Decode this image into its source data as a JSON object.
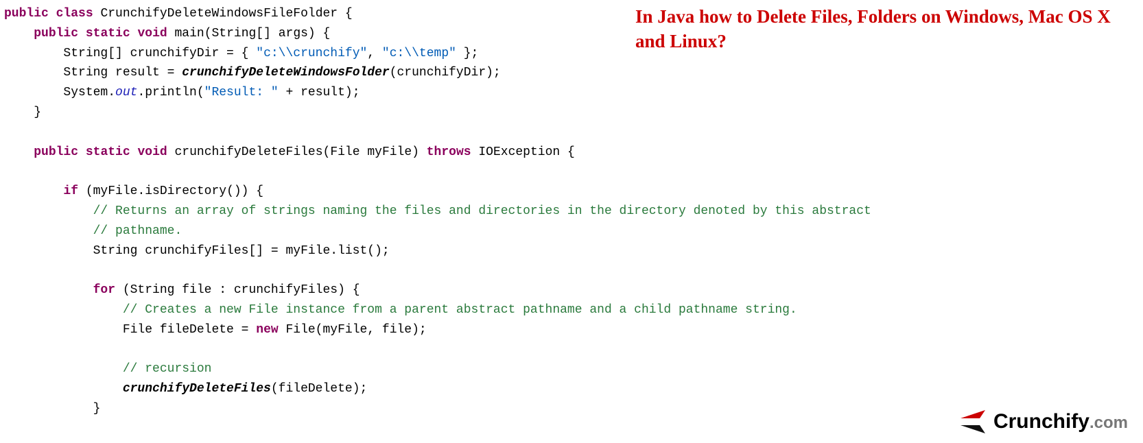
{
  "title": "In Java how to Delete Files, Folders on Windows, Mac OS X and Linux?",
  "code": {
    "l1_kw1": "public",
    "l1_kw2": "class",
    "l1_name": "CrunchifyDeleteWindowsFileFolder",
    "l1_brace": " {",
    "l2_kw1": "public",
    "l2_kw2": "static",
    "l2_kw3": "void",
    "l2_rest": " main(String[] args) {",
    "l3_pre": "        String[] crunchifyDir = { ",
    "l3_s1": "\"c:\\\\crunchify\"",
    "l3_mid": ", ",
    "l3_s2": "\"c:\\\\temp\"",
    "l3_post": " };",
    "l4_pre": "        String result = ",
    "l4_call": "crunchifyDeleteWindowsFolder",
    "l4_post": "(crunchifyDir);",
    "l5_pre": "        System.",
    "l5_out": "out",
    "l5_mid": ".println(",
    "l5_s": "\"Result: \"",
    "l5_post": " + result);",
    "l6": "    }",
    "l7_kw1": "public",
    "l7_kw2": "static",
    "l7_kw3": "void",
    "l7_name": " crunchifyDeleteFiles(File myFile) ",
    "l7_kw4": "throws",
    "l7_post": " IOException {",
    "l8_kw": "if",
    "l8_post": " (myFile.isDirectory()) {",
    "l9": "            // Returns an array of strings naming the files and directories in the directory denoted by this abstract",
    "l10": "            // pathname.",
    "l11": "            String crunchifyFiles[] = myFile.list();",
    "l12_kw": "for",
    "l12_post": " (String file : crunchifyFiles) {",
    "l13": "                // Creates a new File instance from a parent abstract pathname and a child pathname string.",
    "l14_pre": "                File fileDelete = ",
    "l14_kw": "new",
    "l14_post": " File(myFile, file);",
    "l15": "                // recursion",
    "l16_pre": "                ",
    "l16_call": "crunchifyDeleteFiles",
    "l16_post": "(fileDelete);",
    "l17": "            }"
  },
  "logo": {
    "brand": "Crunchify",
    "suffix": ".com"
  }
}
